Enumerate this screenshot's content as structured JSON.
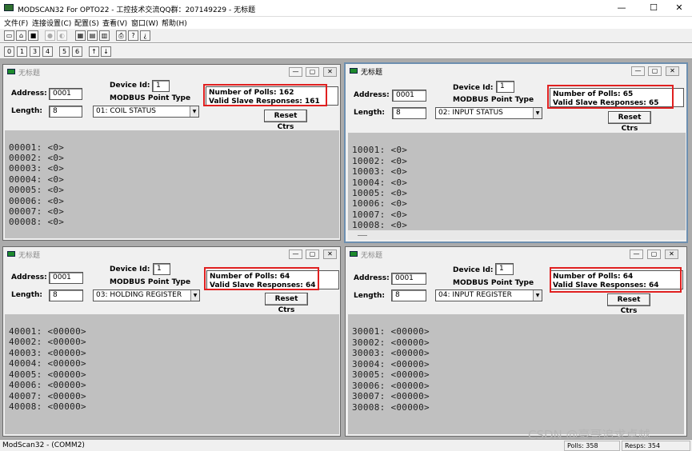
{
  "app": {
    "title": "MODSCAN32 For OPTO22 - 工控技术交流QQ群：207149229 - 无标题"
  },
  "window_controls": {
    "minimize": "—",
    "maximize": "☐",
    "close": "✕"
  },
  "menu": [
    "文件(F)",
    "连接设置(C)",
    "配置(S)",
    "查看(V)",
    "窗口(W)",
    "帮助(H)"
  ],
  "toolbar1": [
    "new-file-icon",
    "open-folder-icon",
    "save-icon",
    "connect-icon",
    "disconnect-icon",
    "display-config-icon",
    "tile-icon",
    "cascade-icon",
    "print-icon",
    "help-icon",
    "context-help-icon"
  ],
  "toolbar2": [
    "coil-icon",
    "input-status-icon",
    "holding-icon",
    "input-reg-icon",
    "write-coil-icon",
    "write-reg-icon",
    "tx-icon",
    "rx-icon"
  ],
  "windows": [
    {
      "title": "无标题",
      "address_label": "Address:",
      "address": "0001",
      "length_label": "Length:",
      "length": "8",
      "device_id_label": "Device Id:",
      "device_id": "1",
      "point_type_label": "MODBUS Point Type",
      "point_type": "01: COIL STATUS",
      "polls_text": "Number of Polls: 162",
      "valid_text": "Valid Slave Responses: 161",
      "reset_label": "Reset Ctrs",
      "lines": [
        "00001: <0>",
        "00002: <0>",
        "00003: <0>",
        "00004: <0>",
        "00005: <0>",
        "00006: <0>",
        "00007: <0>",
        "00008: <0>"
      ]
    },
    {
      "title": "无标题",
      "address_label": "Address:",
      "address": "0001",
      "length_label": "Length:",
      "length": "8",
      "device_id_label": "Device Id:",
      "device_id": "1",
      "point_type_label": "MODBUS Point Type",
      "point_type": "02: INPUT STATUS",
      "polls_text": "Number of Polls: 65",
      "valid_text": "Valid Slave Responses: 65",
      "reset_label": "Reset Ctrs",
      "lines": [
        "10001: <0>",
        "10002: <0>",
        "10003: <0>",
        "10004: <0>",
        "10005: <0>",
        "10006: <0>",
        "10007: <0>",
        "10008: <0>"
      ]
    },
    {
      "title": "无标题",
      "address_label": "Address:",
      "address": "0001",
      "length_label": "Length:",
      "length": "8",
      "device_id_label": "Device Id:",
      "device_id": "1",
      "point_type_label": "MODBUS Point Type",
      "point_type": "03: HOLDING REGISTER",
      "polls_text": "Number of Polls: 64",
      "valid_text": "Valid Slave Responses: 64",
      "reset_label": "Reset Ctrs",
      "lines": [
        "40001: <00000>",
        "40002: <00000>",
        "40003: <00000>",
        "40004: <00000>",
        "40005: <00000>",
        "40006: <00000>",
        "40007: <00000>",
        "40008: <00000>"
      ]
    },
    {
      "title": "无标题",
      "address_label": "Address:",
      "address": "0001",
      "length_label": "Length:",
      "length": "8",
      "device_id_label": "Device Id:",
      "device_id": "1",
      "point_type_label": "MODBUS Point Type",
      "point_type": "04: INPUT REGISTER",
      "polls_text": "Number of Polls: 64",
      "valid_text": "Valid Slave Responses: 64",
      "reset_label": "Reset Ctrs",
      "lines": [
        "30001: <00000>",
        "30002: <00000>",
        "30003: <00000>",
        "30004: <00000>",
        "30005: <00000>",
        "30006: <00000>",
        "30007: <00000>",
        "30008: <00000>"
      ]
    }
  ],
  "status": {
    "text": "ModScan32 - (COMM2)",
    "polls": "Polls: 358",
    "resps": "Resps: 354"
  },
  "watermark": "CSDN @豪哥追求卓越",
  "colors": {
    "highlight": "#e02020",
    "data_bg": "#c0c0c0",
    "active_border": "#6d8fb0"
  }
}
